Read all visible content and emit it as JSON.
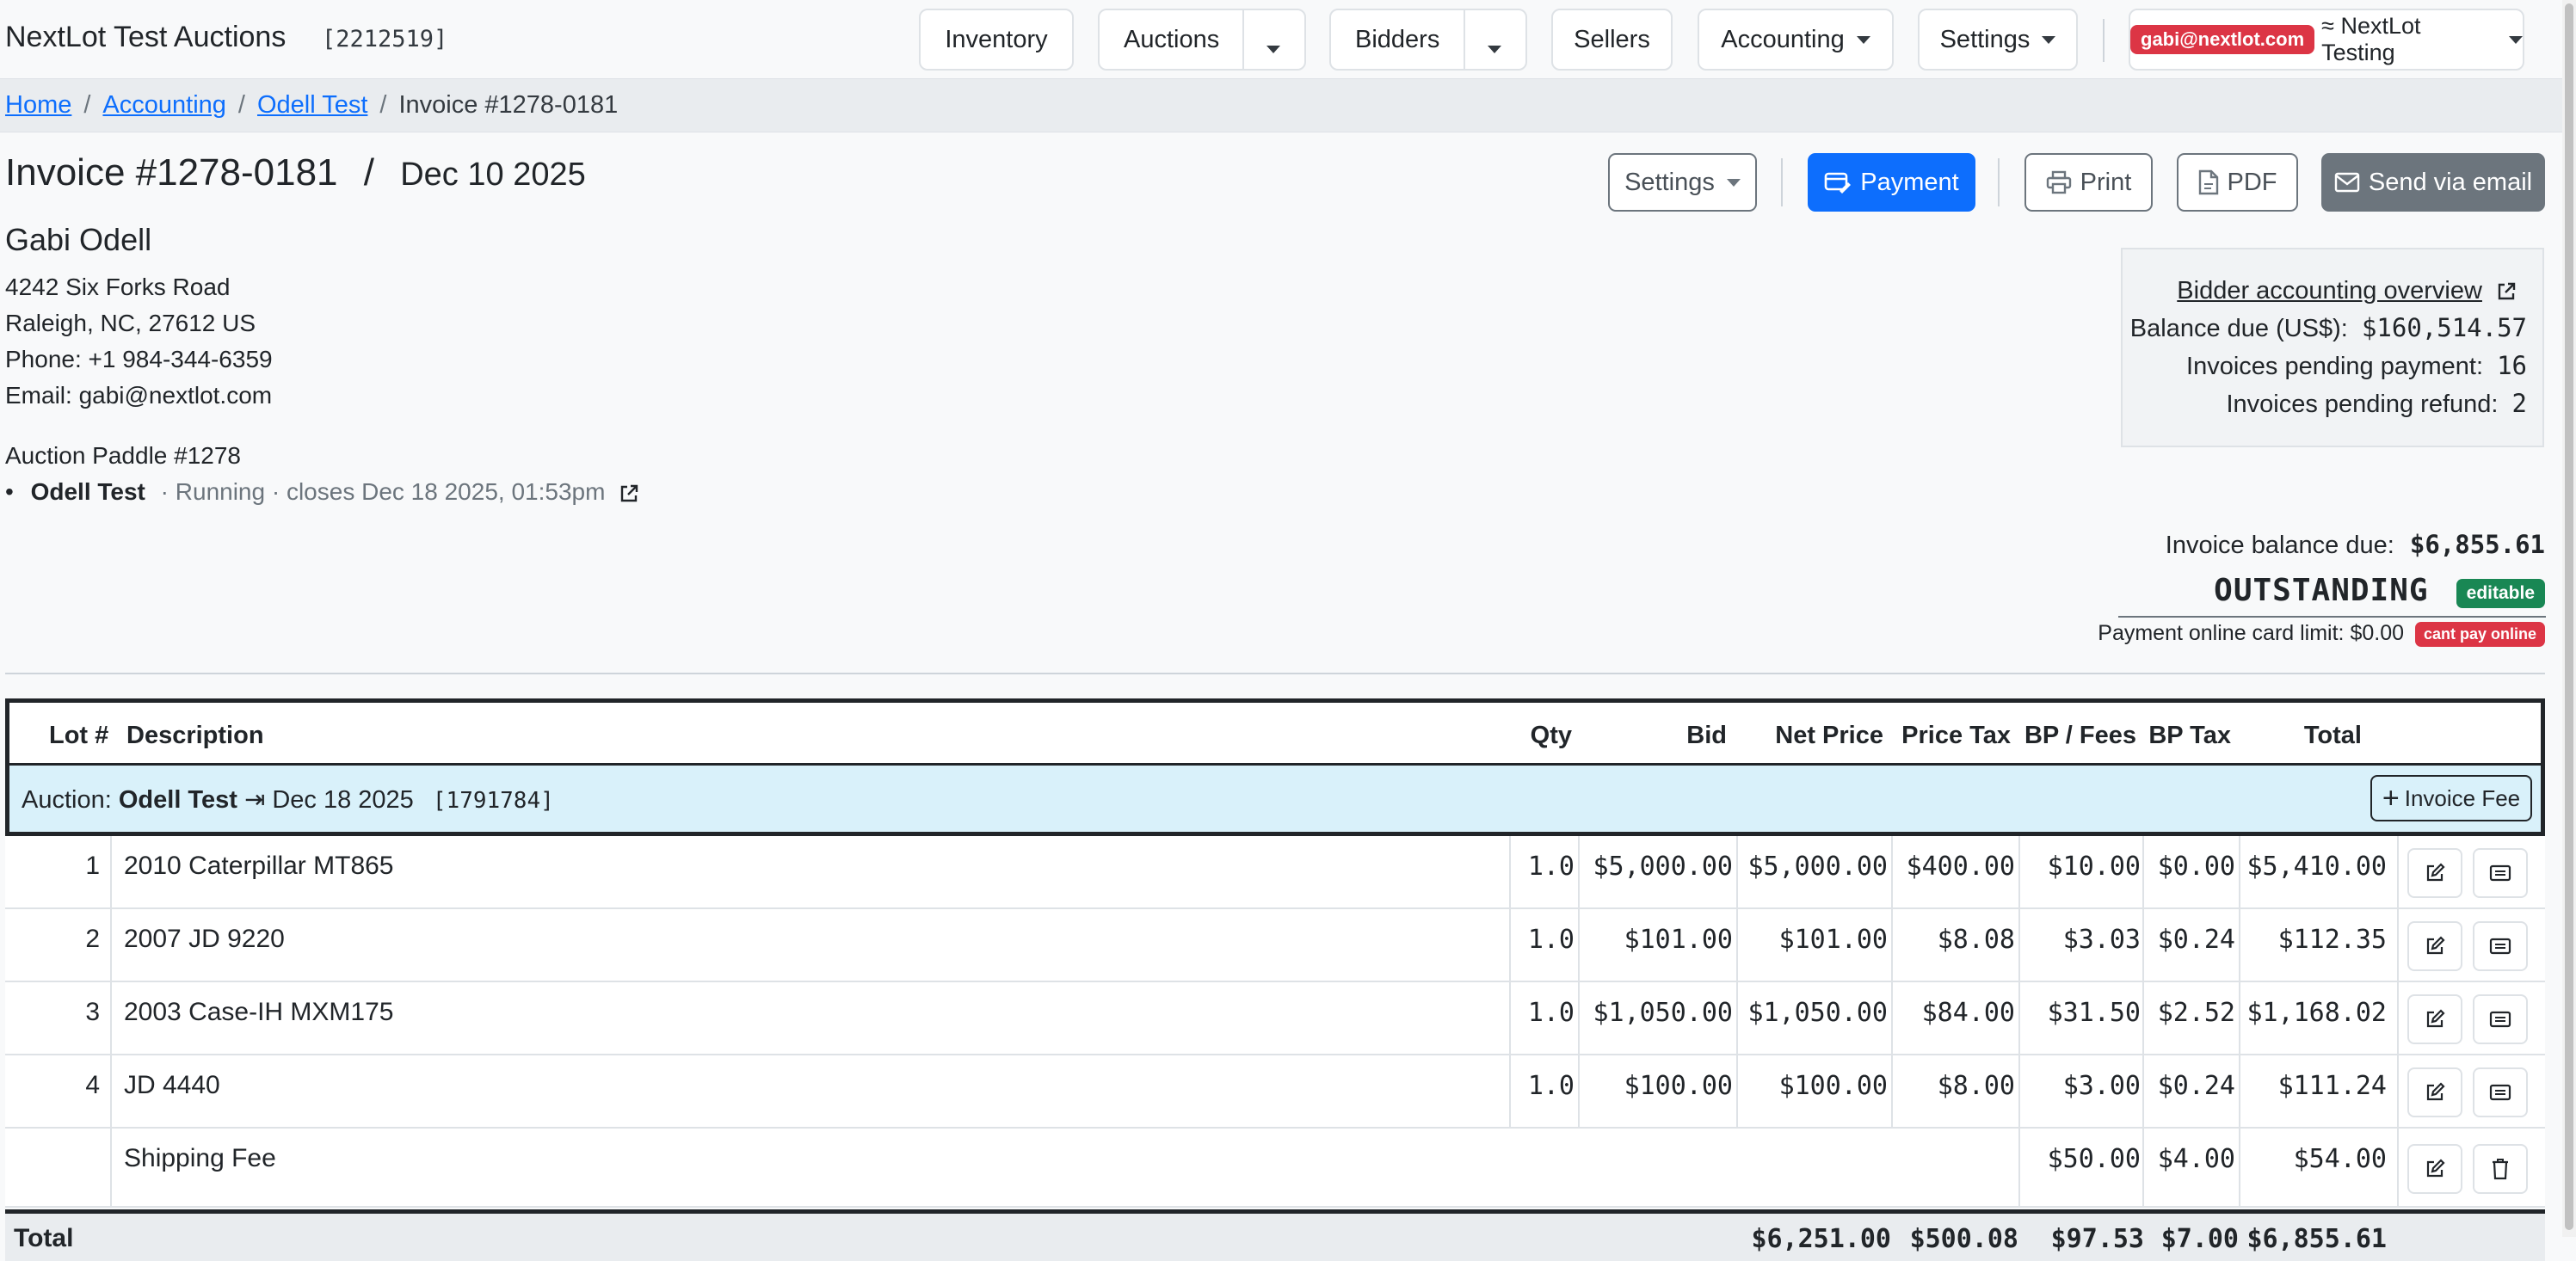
{
  "navbar": {
    "brand": "NextLot Test Auctions",
    "brand_id": "[2212519]",
    "inventory": "Inventory",
    "auctions": "Auctions",
    "bidders": "Bidders",
    "sellers": "Sellers",
    "accounting": "Accounting",
    "settings": "Settings",
    "user_email": "gabi@nextlot.com",
    "org": "≈ NextLot Testing"
  },
  "breadcrumb": {
    "home": "Home",
    "accounting": "Accounting",
    "bidder": "Odell Test",
    "current": "Invoice #1278-0181",
    "separator": "/"
  },
  "invoice": {
    "title": "Invoice #1278-0181",
    "slash": "/",
    "date": "Dec 10 2025"
  },
  "actions": {
    "settings": "Settings",
    "payment": "Payment",
    "print": "Print",
    "pdf": "PDF",
    "email": "Send via email"
  },
  "customer": {
    "name": "Gabi Odell",
    "address1": "4242 Six Forks Road",
    "address2": "Raleigh, NC, 27612 US",
    "phone": "Phone: +1 984-344-6359",
    "email": "Email: gabi@nextlot.com"
  },
  "auction_info": {
    "paddle": "Auction Paddle #1278",
    "bullet": "•",
    "auction_name": "Odell Test",
    "status": "· Running · closes Dec 18 2025, 01:53pm"
  },
  "account": {
    "overview_link": "Bidder accounting overview",
    "balance_label": "Balance due (US$):",
    "balance_value": "$160,514.57",
    "pending_payment_label": "Invoices pending payment:",
    "pending_payment_value": "16",
    "pending_refund_label": "Invoices pending refund:",
    "pending_refund_value": "2"
  },
  "invoice_status": {
    "balance_label": "Invoice balance due:",
    "balance_value": "$6,855.61",
    "status": "OUTSTANDING",
    "editable_badge": "editable",
    "card_limit": "Payment online card limit: $0.00",
    "cant_pay_badge": "cant pay online"
  },
  "table": {
    "headers": {
      "lot": "Lot #",
      "description": "Description",
      "qty": "Qty",
      "bid": "Bid",
      "net_price": "Net Price",
      "price_tax": "Price Tax",
      "bp_fees": "BP / Fees",
      "bp_tax": "BP Tax",
      "total": "Total"
    },
    "auction_band": {
      "prefix": "Auction:",
      "name": "Odell Test",
      "arrow": "⇥",
      "date": "Dec 18 2025",
      "id": "[1791784]",
      "invoice_fee_button": "Invoice Fee"
    },
    "rows": [
      {
        "lot": "1",
        "description": "2010 Caterpillar MT865",
        "qty": "1.0",
        "bid": "$5,000.00",
        "net_price": "$5,000.00",
        "price_tax": "$400.00",
        "bp_fees": "$10.00",
        "bp_tax": "$0.00",
        "total": "$5,410.00"
      },
      {
        "lot": "2",
        "description": "2007 JD 9220",
        "qty": "1.0",
        "bid": "$101.00",
        "net_price": "$101.00",
        "price_tax": "$8.08",
        "bp_fees": "$3.03",
        "bp_tax": "$0.24",
        "total": "$112.35"
      },
      {
        "lot": "3",
        "description": "2003 Case-IH MXM175",
        "qty": "1.0",
        "bid": "$1,050.00",
        "net_price": "$1,050.00",
        "price_tax": "$84.00",
        "bp_fees": "$31.50",
        "bp_tax": "$2.52",
        "total": "$1,168.02"
      },
      {
        "lot": "4",
        "description": "JD 4440",
        "qty": "1.0",
        "bid": "$100.00",
        "net_price": "$100.00",
        "price_tax": "$8.00",
        "bp_fees": "$3.00",
        "bp_tax": "$0.24",
        "total": "$111.24"
      }
    ],
    "fee_row": {
      "description": "Shipping Fee",
      "bp_fees": "$50.00",
      "bp_tax": "$4.00",
      "total": "$54.00"
    },
    "totals": {
      "label": "Total",
      "net_price": "$6,251.00",
      "price_tax": "$500.08",
      "bp_fees": "$97.53",
      "bp_tax": "$7.00",
      "total": "$6,855.61"
    }
  }
}
